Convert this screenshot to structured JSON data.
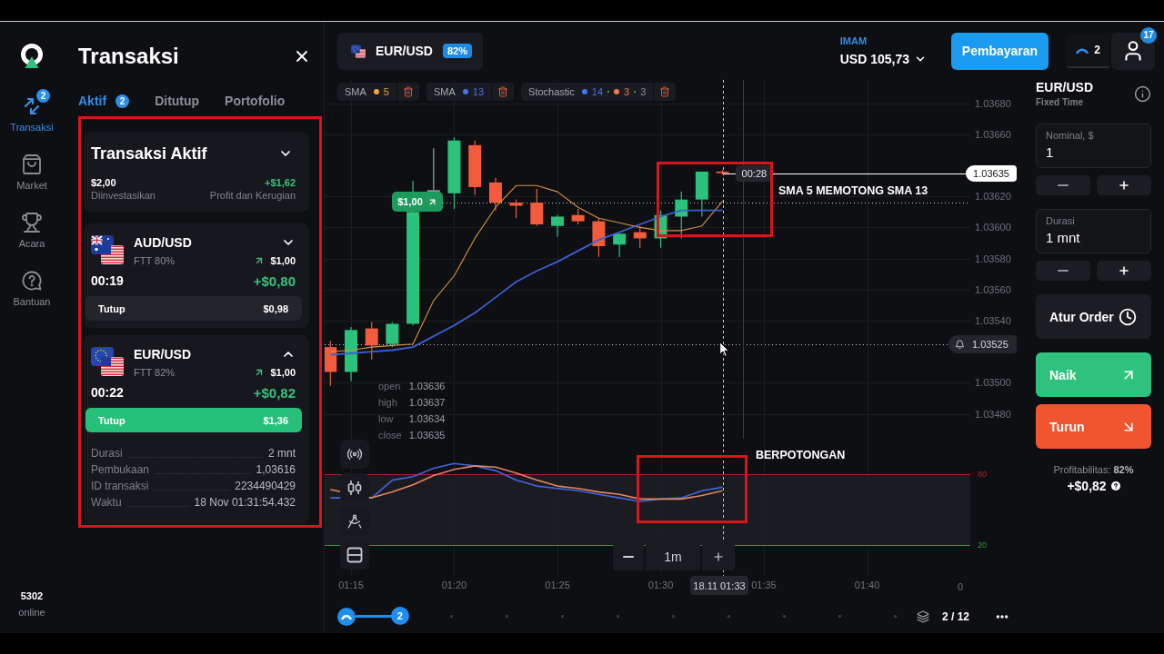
{
  "nav": {
    "items": [
      {
        "kind": "trades",
        "label": "Transaksi",
        "badge": "2",
        "selected": true
      },
      {
        "kind": "market",
        "label": "Market",
        "selected": false
      },
      {
        "kind": "events",
        "label": "Acara",
        "selected": false
      },
      {
        "kind": "help",
        "label": "Bantuan",
        "selected": false
      }
    ],
    "online_count": "5302",
    "online_label": "online"
  },
  "transactions": {
    "title": "Transaksi",
    "tabs": [
      {
        "label": "Aktif",
        "badge": "2",
        "selected": true
      },
      {
        "label": "Ditutup",
        "selected": false
      },
      {
        "label": "Portofolio",
        "selected": false
      }
    ],
    "summary": {
      "title": "Transaksi Aktif",
      "invested": "$2,00",
      "invested_label": "Diinvestasikan",
      "profit": "+$1,62",
      "profit_label": "Profit dan Kerugian"
    },
    "trades": [
      {
        "kind": "aud",
        "pair": "AUD/USD",
        "type": "FTT 80%",
        "up": true,
        "amount": "$1,00",
        "timer": "00:19",
        "profit": "+$0,80",
        "expanded": false,
        "close": {
          "label": "Tutup",
          "value": "$0,98",
          "highlighted": false
        }
      },
      {
        "kind": "eur",
        "pair": "EUR/USD",
        "type": "FTT 82%",
        "up": true,
        "amount": "$1,00",
        "timer": "00:22",
        "profit": "+$0,82",
        "expanded": true,
        "close": {
          "label": "Tutup",
          "value": "$1,36",
          "highlighted": true
        },
        "details": [
          {
            "label": "Durasi",
            "value": "2 mnt"
          },
          {
            "label": "Pembukaan",
            "value": "1,03616"
          },
          {
            "label": "ID transaksi",
            "value": "2234490429"
          },
          {
            "label": "Waktu",
            "value": "18 Nov 01:31:54.432"
          }
        ]
      }
    ]
  },
  "topbar": {
    "asset": {
      "pair": "EUR/USD",
      "payout": "82%"
    },
    "account": {
      "name": "IMAM",
      "balance": "USD 105,73"
    },
    "payment_button": "Pembayaran",
    "open_trades": "2",
    "notifications": "17"
  },
  "chart": {
    "indicators": [
      {
        "name": "SMA",
        "params": [
          {
            "value": "5",
            "color": "#f0a43a"
          }
        ]
      },
      {
        "name": "SMA",
        "params": [
          {
            "value": "13",
            "color": "#4a73f0"
          }
        ]
      },
      {
        "name": "Stochastic",
        "params": [
          {
            "value": "14",
            "color": "#4a73f0"
          },
          {
            "value": "3",
            "color": "#ee7a55"
          },
          {
            "value": "3"
          }
        ]
      }
    ],
    "ohlc": [
      {
        "label": "open",
        "value": "1.03636"
      },
      {
        "label": "high",
        "value": "1.03637"
      },
      {
        "label": "low",
        "value": "1.03634"
      },
      {
        "label": "close",
        "value": "1.03635"
      }
    ],
    "trade_marker": {
      "amount": "$1,00",
      "up": true
    },
    "countdown": "00:28",
    "cursor_time": "18.11 01:33",
    "time_axis_cut_label": "0",
    "zoom": "1m",
    "chart_data": [
      {
        "type": "candlestick",
        "x": [
          1.2333,
          1.25,
          1.2667,
          1.2833,
          1.3,
          1.3167,
          1.3333,
          1.35,
          1.3667,
          1.3833,
          1.4,
          1.4167,
          1.4333,
          1.45,
          1.4667,
          1.4833,
          1.5,
          1.5167,
          1.5333,
          1.55
        ],
        "ohlc": [
          [
            1.03523,
            1.03527,
            1.03498,
            1.03507
          ],
          [
            1.03507,
            1.03536,
            1.03501,
            1.03534
          ],
          [
            1.03535,
            1.03539,
            1.03515,
            1.03524
          ],
          [
            1.03525,
            1.03539,
            1.03523,
            1.03538
          ],
          [
            1.03538,
            1.0363,
            1.03537,
            1.0361
          ],
          [
            1.03624,
            1.03651,
            1.03624,
            1.03624
          ],
          [
            1.03622,
            1.03658,
            1.03612,
            1.03656
          ],
          [
            1.03653,
            1.03656,
            1.03621,
            1.03626
          ],
          [
            1.03629,
            1.03632,
            1.03611,
            1.03616
          ],
          [
            1.03616,
            1.03618,
            1.03606,
            1.03614
          ],
          [
            1.03616,
            1.03625,
            1.03601,
            1.03602
          ],
          [
            1.03601,
            1.03608,
            1.03594,
            1.03607
          ],
          [
            1.03608,
            1.03612,
            1.03602,
            1.03604
          ],
          [
            1.03604,
            1.03606,
            1.03581,
            1.03588
          ],
          [
            1.03589,
            1.03596,
            1.03581,
            1.03596
          ],
          [
            1.03597,
            1.03601,
            1.03587,
            1.03593
          ],
          [
            1.03593,
            1.03611,
            1.03587,
            1.03608
          ],
          [
            1.03607,
            1.03623,
            1.03593,
            1.03618
          ],
          [
            1.03618,
            1.03636,
            1.03607,
            1.03636
          ],
          [
            1.03636,
            1.03637,
            1.03634,
            1.03635
          ]
        ],
        "series": [
          {
            "type": "line",
            "color": "#d9923c",
            "values": [
              1.0352,
              1.03521,
              1.03523,
              1.03524,
              1.03525,
              1.03553,
              1.03569,
              1.03593,
              1.03613,
              1.03627,
              1.03627,
              1.03623,
              1.03613,
              1.03606,
              1.03603,
              1.036,
              1.03598,
              1.03598,
              1.03601,
              1.03617
            ]
          },
          {
            "type": "line",
            "color": "#3b5fd6",
            "values": [
              1.03518,
              1.03519,
              1.0352,
              1.03521,
              1.03523,
              1.0353,
              1.03537,
              1.03545,
              1.03555,
              1.03565,
              1.03572,
              1.03578,
              1.03585,
              1.03592,
              1.03597,
              1.03602,
              1.03607,
              1.03611,
              1.03611,
              1.03611
            ]
          }
        ],
        "xlim": [
          1.2287,
          1.75
        ],
        "ylim": [
          1.03464,
          1.03695
        ],
        "xticks": [
          1.25,
          1.3333,
          1.4167,
          1.5,
          1.5833,
          1.6667
        ],
        "yticks": [
          {
            "value": 1.0368,
            "label": "1.03680"
          },
          {
            "value": 1.0366,
            "label": "1.03660"
          },
          {
            "value": 1.0362,
            "label": "1.03620"
          },
          {
            "value": 1.036,
            "label": "1.03600"
          },
          {
            "value": 1.0358,
            "label": "1.03580"
          },
          {
            "value": 1.0356,
            "label": "1.03560"
          },
          {
            "value": 1.0354,
            "label": "1.03540"
          },
          {
            "value": 1.035,
            "label": "1.03500"
          },
          {
            "value": 1.0348,
            "label": "1.03480"
          }
        ],
        "tick_labels": "y",
        "grid": true,
        "ref_lines": [
          {
            "axis": "y",
            "value": 1.03635,
            "label": "1.03635",
            "color": "#ffffff",
            "line_style": "solid"
          },
          {
            "axis": "y",
            "value": 1.03616,
            "color": "#c8ccd2",
            "line_style": "dotted"
          },
          {
            "axis": "y",
            "value": 1.03525,
            "label": "1.03525",
            "color": "#c8ccd2",
            "line_style": "dotted"
          },
          {
            "axis": "x",
            "value": 1.55,
            "color": "#c8ccd2",
            "line_style": "dashed"
          },
          {
            "axis": "x",
            "value": 1.5667,
            "color": "#3a3c42",
            "line_style": "solid"
          }
        ]
      },
      {
        "type": "line",
        "series": [
          {
            "color": "#4066e0",
            "x": [
              1.2333,
              1.2667,
              1.2833,
              1.3,
              1.3167,
              1.3333,
              1.35,
              1.3667,
              1.3833,
              1.4,
              1.4167,
              1.4333,
              1.45,
              1.4667,
              1.4833,
              1.5,
              1.5167,
              1.5333,
              1.55
            ],
            "values": [
              60,
              60,
              75,
              78,
              85,
              89,
              87,
              83,
              75,
              70,
              68,
              66,
              63,
              60,
              57,
              59,
              60,
              66,
              69
            ]
          },
          {
            "color": "#e4845c",
            "x": [
              1.2333,
              1.2667,
              1.2833,
              1.3,
              1.3167,
              1.3333,
              1.35,
              1.3667,
              1.3833,
              1.4,
              1.4167,
              1.4333,
              1.45,
              1.4667,
              1.4833,
              1.5,
              1.5167,
              1.5333,
              1.55
            ],
            "values": [
              67,
              60,
              65,
              71,
              79,
              84,
              87,
              86,
              81,
              75,
              70,
              68,
              65,
              63,
              59,
              59,
              59,
              62,
              66
            ]
          }
        ],
        "xlim": [
          1.2287,
          1.75
        ],
        "ylim": [
          -6,
          110
        ],
        "xticks": [
          {
            "value": 1.25,
            "label": "01:15"
          },
          {
            "value": 1.3333,
            "label": "01:20"
          },
          {
            "value": 1.4167,
            "label": "01:25"
          },
          {
            "value": 1.5,
            "label": "01:30"
          },
          {
            "value": 1.5833,
            "label": "01:35"
          },
          {
            "value": 1.6667,
            "label": "01:40"
          }
        ],
        "yticks": [
          20,
          80
        ],
        "grid": true,
        "bands": [
          {
            "axis": "y",
            "from": 20,
            "to": 80,
            "color": "#1b1c21"
          }
        ],
        "ref_lines": [
          {
            "axis": "y",
            "value": 80,
            "color": "#a8262c",
            "line_style": "solid"
          },
          {
            "axis": "y",
            "value": 20,
            "color": "#2f9a4c",
            "line_style": "solid"
          },
          {
            "axis": "x",
            "value": 1.55,
            "color": "#c8ccd2",
            "line_style": "dashed"
          }
        ]
      }
    ],
    "timeline": {
      "count": "2",
      "level": 0.08,
      "pages": "2 / 12"
    }
  },
  "order_panel": {
    "pair": "EUR/USD",
    "mode": "Fixed Time",
    "amount": {
      "label": "Nominal, $",
      "value": "1"
    },
    "duration": {
      "label": "Durasi",
      "value": "1 mnt"
    },
    "schedule_button": "Atur Order",
    "up_button": "Naik",
    "down_button": "Turun",
    "profitability": "Profitabilitas: **82%**",
    "expected_profit": "+$0,82"
  },
  "overlay_notes": [
    {
      "text": "SMA 5 MEMOTONG SMA 13"
    },
    {
      "text": "BERPOTONGAN"
    }
  ]
}
